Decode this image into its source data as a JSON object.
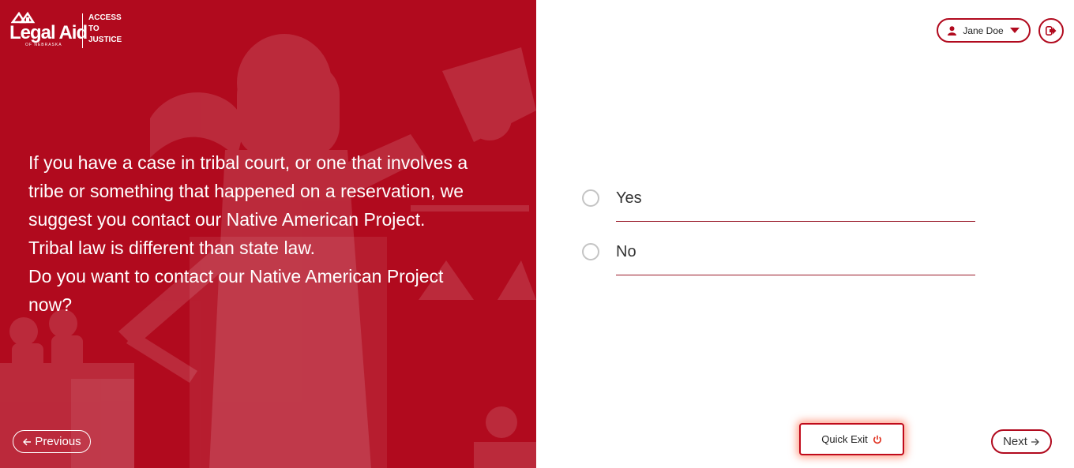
{
  "brand": {
    "name": "Legal Aid",
    "subname": "OF NEBRASKA",
    "tagline": [
      "ACCESS",
      "TO",
      "JUSTICE"
    ]
  },
  "question": {
    "lines": [
      "If you have a case in tribal court, or one that involves a",
      "tribe or something that happened on a reservation, we",
      "suggest you contact our Native American Project.",
      "Tribal law is different than state law.",
      "Do you want to contact our Native American Project",
      "now?"
    ]
  },
  "nav": {
    "previous_label": "Previous",
    "next_label": "Next",
    "quick_exit_label": "Quick Exit"
  },
  "user": {
    "name": "Jane Doe"
  },
  "options": [
    {
      "label": "Yes",
      "selected": false
    },
    {
      "label": "No",
      "selected": false
    }
  ],
  "colors": {
    "brand_red": "#b10a1e",
    "radio_border": "#c4c4c4"
  },
  "icons": {
    "user": "user-icon",
    "caret": "caret-down-icon",
    "logout": "sign-out-icon",
    "power": "power-icon",
    "arrow_left": "arrow-left-icon",
    "arrow_right": "arrow-right-icon"
  }
}
